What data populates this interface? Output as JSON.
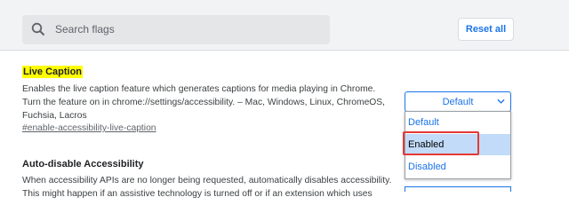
{
  "header": {
    "search_placeholder": "Search flags",
    "reset_label": "Reset all"
  },
  "flags": [
    {
      "title": "Live Caption",
      "description": "Enables the live caption feature which generates captions for media playing in Chrome. Turn the feature on in chrome://settings/accessibility. – Mac, Windows, Linux, ChromeOS, Fuchsia, Lacros",
      "link": "#enable-accessibility-live-caption",
      "select_value": "Default",
      "options": [
        "Default",
        "Enabled",
        "Disabled"
      ],
      "highlighted_option": "Enabled"
    },
    {
      "title": "Auto-disable Accessibility",
      "description": "When accessibility APIs are no longer being requested, automatically disables accessibility. This might happen if an assistive technology is turned off or if an extension which uses"
    }
  ],
  "colors": {
    "accent": "#1a73e8",
    "title_highlight": "#ffff00",
    "annotation_box": "#e53935",
    "hover_option": "#c2dbf8"
  }
}
